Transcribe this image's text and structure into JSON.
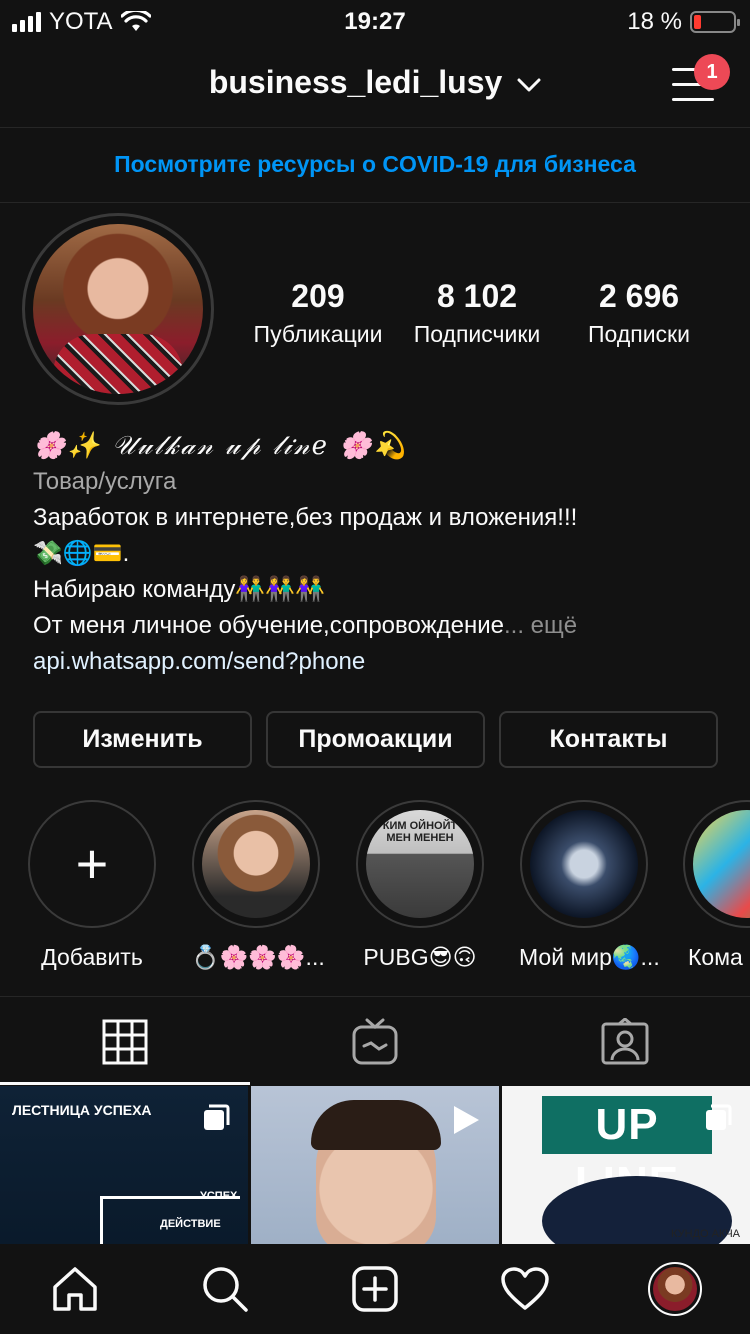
{
  "status": {
    "carrier": "YOTA",
    "time": "19:27",
    "battery": "18 %",
    "battery_level": 0.18,
    "battery_color": "#ff3b30"
  },
  "header": {
    "username": "business_ledi_lusy",
    "notifications": "1"
  },
  "banner": {
    "text": "Посмотрите ресурсы о COVID-19 для бизнеса",
    "color": "#0095f6"
  },
  "profile": {
    "stats": [
      {
        "value": "209",
        "label": "Публикации"
      },
      {
        "value": "8 102",
        "label": "Подписчики"
      },
      {
        "value": "2 696",
        "label": "Подписки"
      }
    ],
    "name": "🌸✨ 𝒰𝓊𝓁𝓀𝒶𝓃 𝓊𝓅 𝓁𝒾𝓃𝑒 🌸💫",
    "category": "Товар/услуга",
    "bio_line1": "Заработок в интернете,без продаж и вложения!!!",
    "bio_line2": "💸🌐💳.",
    "bio_line3": "Набираю команду👫👫👫",
    "bio_line4": "От меня личное обучение,сопровождение",
    "more": "... ещё",
    "link": "api.whatsapp.com/send?phone"
  },
  "actions": {
    "edit": "Изменить",
    "promo": "Промоакции",
    "contacts": "Контакты"
  },
  "highlights": [
    {
      "label": "Добавить"
    },
    {
      "label": "💍🌸🌸🌸..."
    },
    {
      "label": "PUBG😎🙃",
      "caption": "КИМ ОЙНОЙТ МЕН МЕНЕН"
    },
    {
      "label": "Мой мир🌏..."
    },
    {
      "label": "Кома"
    }
  ],
  "grid": {
    "tile1_title": "ЛЕСТНИЦА УСПЕХА",
    "tile1_step1": "УСПЕХ",
    "tile1_step2": "ДЕЙСТВИЕ",
    "tile3_title": "UP LINE",
    "tile3_caption": "КУНДО АКЧА"
  },
  "icons": {
    "tab_grid": "grid-icon",
    "tab_igtv": "igtv-icon",
    "tab_tagged": "tagged-icon",
    "nav": [
      "home-icon",
      "search-icon",
      "add-post-icon",
      "heart-icon",
      "profile-avatar"
    ]
  }
}
